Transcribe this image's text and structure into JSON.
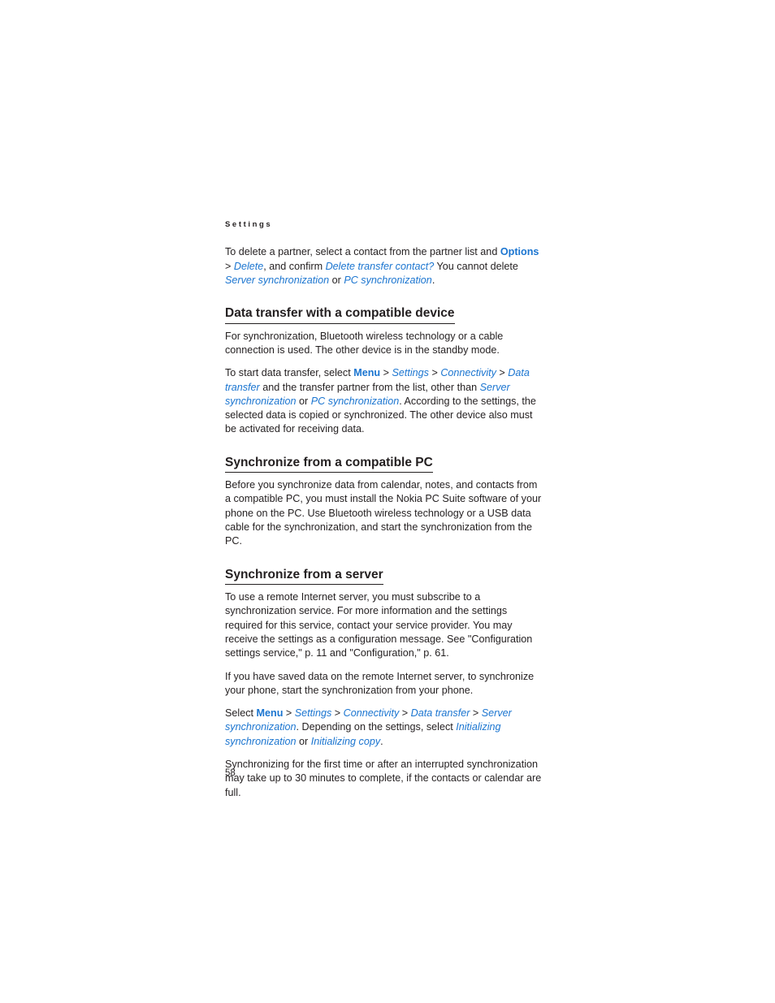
{
  "page": {
    "running_header": "Settings",
    "folio": "58"
  },
  "colors": {
    "link_blue": "#1b75d0",
    "body_text": "#231f20",
    "background": "#ffffff"
  },
  "content": {
    "intro_paragraph": {
      "segments": [
        {
          "text": "To delete a partner, select a contact from the partner list and ",
          "style": "plain"
        },
        {
          "text": "Options",
          "style": "ui-bold"
        },
        {
          "text": " > ",
          "style": "sep"
        },
        {
          "text": "Delete",
          "style": "ui"
        },
        {
          "text": ", and confirm ",
          "style": "plain"
        },
        {
          "text": "Delete transfer contact?",
          "style": "ui"
        },
        {
          "text": " You cannot delete ",
          "style": "plain"
        },
        {
          "text": "Server synchronization",
          "style": "ui"
        },
        {
          "text": " or ",
          "style": "plain"
        },
        {
          "text": "PC synchronization",
          "style": "ui"
        },
        {
          "text": ".",
          "style": "plain"
        }
      ],
      "plain_text": "To delete a partner, select a contact from the partner list and Options > Delete, and confirm Delete transfer contact? You cannot delete Server synchronization or PC synchronization."
    },
    "sections": [
      {
        "heading": "Data transfer with a compatible device",
        "paragraphs": [
          {
            "segments": [
              {
                "text": "For synchronization, Bluetooth wireless technology or a cable connection is used. The other device is in the standby mode.",
                "style": "plain"
              }
            ],
            "plain_text": "For synchronization, Bluetooth wireless technology or a cable connection is used. The other device is in the standby mode."
          },
          {
            "segments": [
              {
                "text": "To start data transfer, select ",
                "style": "plain"
              },
              {
                "text": "Menu",
                "style": "ui-bold"
              },
              {
                "text": " > ",
                "style": "sep"
              },
              {
                "text": "Settings",
                "style": "ui"
              },
              {
                "text": " > ",
                "style": "sep"
              },
              {
                "text": "Connectivity",
                "style": "ui"
              },
              {
                "text": " > ",
                "style": "sep"
              },
              {
                "text": "Data transfer",
                "style": "ui"
              },
              {
                "text": " and the transfer partner from the list, other than ",
                "style": "plain"
              },
              {
                "text": "Server synchronization",
                "style": "ui"
              },
              {
                "text": " or ",
                "style": "plain"
              },
              {
                "text": "PC synchronization",
                "style": "ui"
              },
              {
                "text": ". According to the settings, the selected data is copied or synchronized. The other device also must be activated for receiving data.",
                "style": "plain"
              }
            ],
            "plain_text": "To start data transfer, select Menu > Settings > Connectivity > Data transfer and the transfer partner from the list, other than Server synchronization or PC synchronization. According to the settings, the selected data is copied or synchronized. The other device also must be activated for receiving data."
          }
        ]
      },
      {
        "heading": "Synchronize from a compatible PC",
        "paragraphs": [
          {
            "segments": [
              {
                "text": "Before you synchronize data from calendar, notes, and contacts from a compatible PC, you must install the Nokia PC Suite software of your phone on the PC. Use Bluetooth wireless technology or a USB data cable for the synchronization, and start the synchronization from the PC.",
                "style": "plain"
              }
            ],
            "plain_text": "Before you synchronize data from calendar, notes, and contacts from a compatible PC, you must install the Nokia PC Suite software of your phone on the PC. Use Bluetooth wireless technology or a USB data cable for the synchronization, and start the synchronization from the PC."
          }
        ]
      },
      {
        "heading": "Synchronize from a server",
        "paragraphs": [
          {
            "segments": [
              {
                "text": "To use a remote Internet server, you must subscribe to a synchronization service. For more information and the settings required for this service, contact your service provider. You may receive the settings as a configuration message. See \"Configuration settings service,\" p. 11 and \"Configuration,\" p. 61.",
                "style": "plain"
              }
            ],
            "plain_text": "To use a remote Internet server, you must subscribe to a synchronization service. For more information and the settings required for this service, contact your service provider. You may receive the settings as a configuration message. See \"Configuration settings service,\" p. 11 and \"Configuration,\" p. 61."
          },
          {
            "segments": [
              {
                "text": "If you have saved data on the remote Internet server, to synchronize your phone, start the synchronization from your phone.",
                "style": "plain"
              }
            ],
            "plain_text": "If you have saved data on the remote Internet server, to synchronize your phone, start the synchronization from your phone."
          },
          {
            "segments": [
              {
                "text": "Select ",
                "style": "plain"
              },
              {
                "text": "Menu",
                "style": "ui-bold"
              },
              {
                "text": " > ",
                "style": "sep"
              },
              {
                "text": "Settings",
                "style": "ui"
              },
              {
                "text": " > ",
                "style": "sep"
              },
              {
                "text": "Connectivity",
                "style": "ui"
              },
              {
                "text": " > ",
                "style": "sep"
              },
              {
                "text": "Data transfer",
                "style": "ui"
              },
              {
                "text": " > ",
                "style": "sep"
              },
              {
                "text": "Server synchronization",
                "style": "ui"
              },
              {
                "text": ". Depending on the settings, select ",
                "style": "plain"
              },
              {
                "text": "Initializing synchronization",
                "style": "ui"
              },
              {
                "text": " or ",
                "style": "plain"
              },
              {
                "text": "Initializing copy",
                "style": "ui"
              },
              {
                "text": ".",
                "style": "plain"
              }
            ],
            "plain_text": "Select Menu > Settings > Connectivity > Data transfer > Server synchronization. Depending on the settings, select Initializing synchronization or Initializing copy."
          },
          {
            "segments": [
              {
                "text": "Synchronizing for the first time or after an interrupted synchronization may take up to 30 minutes to complete, if the contacts or calendar are full.",
                "style": "plain"
              }
            ],
            "plain_text": "Synchronizing for the first time or after an interrupted synchronization may take up to 30 minutes to complete, if the contacts or calendar are full."
          }
        ]
      }
    ]
  }
}
